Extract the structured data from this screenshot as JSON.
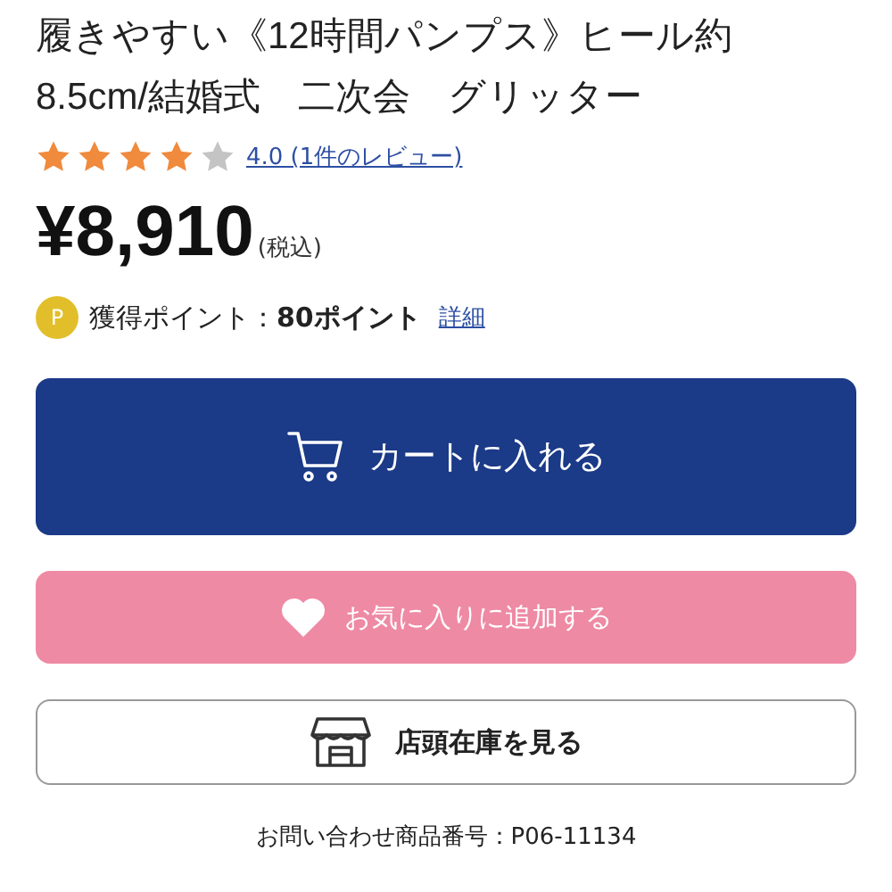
{
  "product": {
    "title": "履きやすい《12時間パンプス》ヒール約8.5cm/結婚式　二次会　グリッター",
    "stars": 4,
    "review_link": "4.0 (1件のレビュー)",
    "price": "¥8,910",
    "tax_note": "(税込)"
  },
  "points": {
    "badge": "P",
    "label": "獲得ポイント：",
    "value": "80ポイント",
    "detail_link": "詳細"
  },
  "buttons": [
    {
      "kind": "cart",
      "label": "カートに入れる"
    },
    {
      "kind": "favorite",
      "label": "お気に入りに追加する"
    },
    {
      "kind": "store",
      "label": "店頭在庫を見る"
    }
  ],
  "inquiry": "お問い合わせ商品番号：P06-11134"
}
